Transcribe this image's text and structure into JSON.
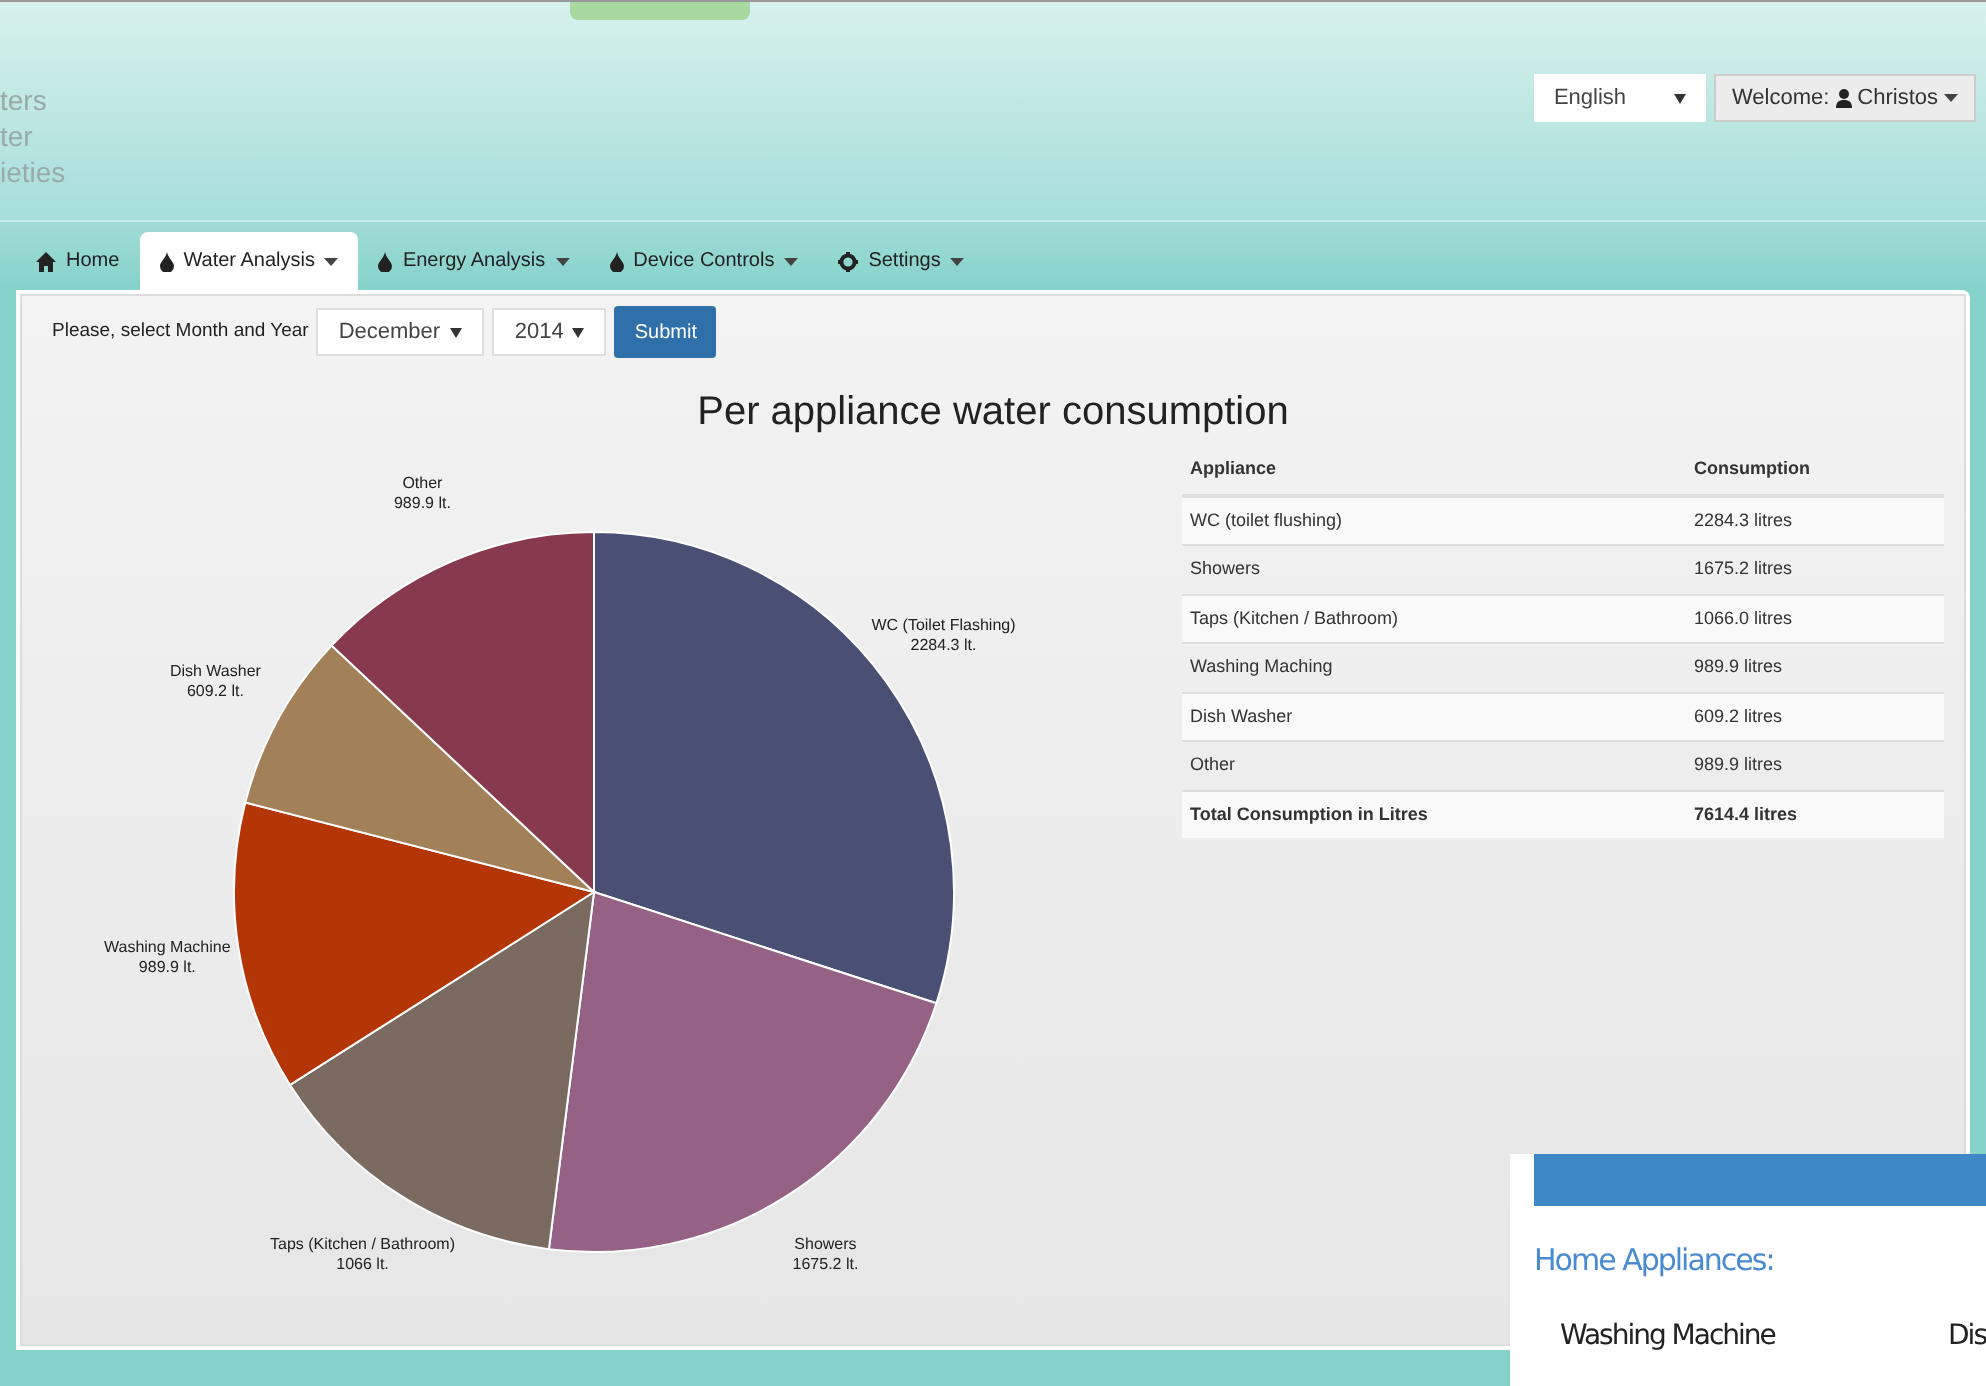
{
  "logo": {
    "lines": [
      "ters",
      "ter",
      "ieties"
    ]
  },
  "header": {
    "language": "English",
    "welcome": "Welcome:",
    "user": "Christos"
  },
  "tabs": [
    {
      "label": "Home",
      "kind": "home",
      "dropdown": false,
      "selected": false
    },
    {
      "label": "Water Analysis",
      "kind": "drop",
      "dropdown": true,
      "selected": true
    },
    {
      "label": "Energy Analysis",
      "kind": "drop",
      "dropdown": true,
      "selected": false
    },
    {
      "label": "Device Controls",
      "kind": "drop",
      "dropdown": true,
      "selected": false
    },
    {
      "label": "Settings",
      "kind": "gear",
      "dropdown": true,
      "selected": false
    }
  ],
  "form": {
    "prompt": "Please, select Month and Year",
    "month": "December",
    "year": "2014",
    "submit": "Submit"
  },
  "chart_data": {
    "type": "pie",
    "title": "Per appliance water consumption",
    "categories": [
      "WC (Toilet Flashing)",
      "Showers",
      "Taps (Kitchen / Bathroom)",
      "Washing Machine",
      "Dish Washer",
      "Other"
    ],
    "values": [
      2284.3,
      1675.2,
      1066,
      989.9,
      609.2,
      989.9
    ],
    "value_labels": [
      "2284.3 lt.",
      "1675.2 lt.",
      "1066 lt.",
      "989.9 lt.",
      "609.2 lt.",
      "989.9 lt."
    ],
    "colors": [
      "#4a4f74",
      "#956286",
      "#7a6a60",
      "#b43506",
      "#a38158",
      "#87394d"
    ]
  },
  "table": {
    "columns": [
      "Appliance",
      "Consumption"
    ],
    "rows": [
      [
        "WC (toilet flushing)",
        "2284.3 litres"
      ],
      [
        "Showers",
        "1675.2 litres"
      ],
      [
        "Taps (Kitchen / Bathroom)",
        "1066.0 litres"
      ],
      [
        "Washing Maching",
        "989.9 litres"
      ],
      [
        "Dish Washer",
        "609.2 litres"
      ],
      [
        "Other",
        "989.9 litres"
      ]
    ],
    "total": [
      "Total Consumption in Litres",
      "7614.4 litres"
    ]
  },
  "overlay": {
    "heading": "Home Appliances:",
    "items": [
      "Washing Machine",
      "Dis"
    ]
  }
}
